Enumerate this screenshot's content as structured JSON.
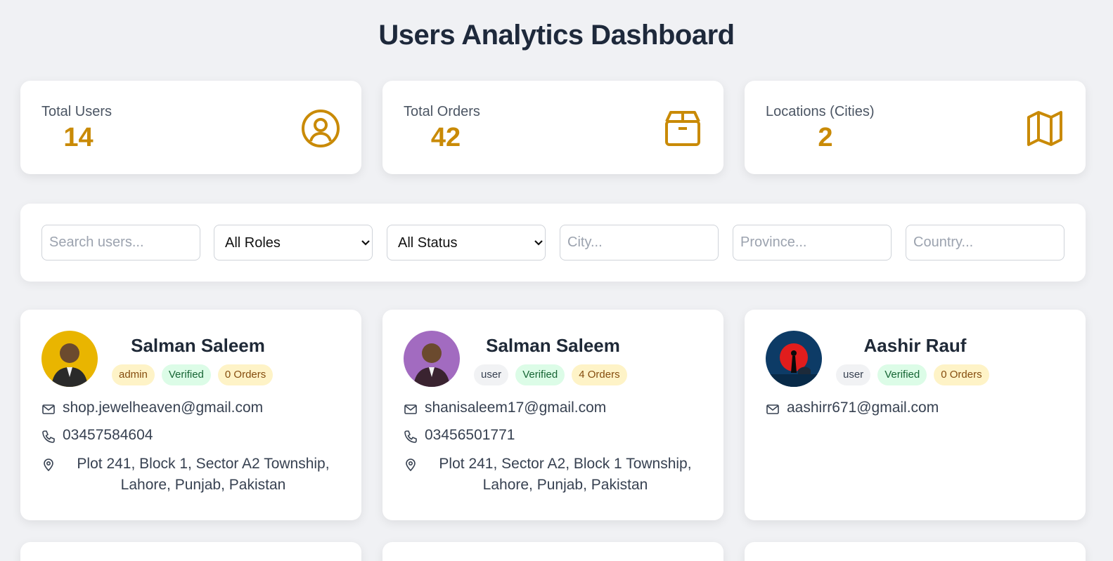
{
  "page": {
    "title": "Users Analytics Dashboard"
  },
  "colors": {
    "accent": "#c98a06",
    "background": "#f0f1f4"
  },
  "stats": [
    {
      "label": "Total Users",
      "value": "14",
      "icon": "user-circle-icon"
    },
    {
      "label": "Total Orders",
      "value": "42",
      "icon": "box-icon"
    },
    {
      "label": "Locations (Cities)",
      "value": "2",
      "icon": "map-icon"
    }
  ],
  "filters": {
    "search_placeholder": "Search users...",
    "role_selected": "All Roles",
    "status_selected": "All Status",
    "city_placeholder": "City...",
    "province_placeholder": "Province...",
    "country_placeholder": "Country..."
  },
  "users": [
    {
      "name": "Salman Saleem",
      "role": "admin",
      "status": "Verified",
      "orders": "0 Orders",
      "email": "shop.jewelheaven@gmail.com",
      "phone": "03457584604",
      "address": "Plot 241, Block 1, Sector A2 Township, Lahore, Punjab, Pakistan"
    },
    {
      "name": "Salman Saleem",
      "role": "user",
      "status": "Verified",
      "orders": "4 Orders",
      "email": "shanisaleem17@gmail.com",
      "phone": "03456501771",
      "address": "Plot 241, Sector A2, Block 1 Township, Lahore, Punjab, Pakistan"
    },
    {
      "name": "Aashir Rauf",
      "role": "user",
      "status": "Verified",
      "orders": "0 Orders",
      "email": "aashirr671@gmail.com"
    }
  ]
}
